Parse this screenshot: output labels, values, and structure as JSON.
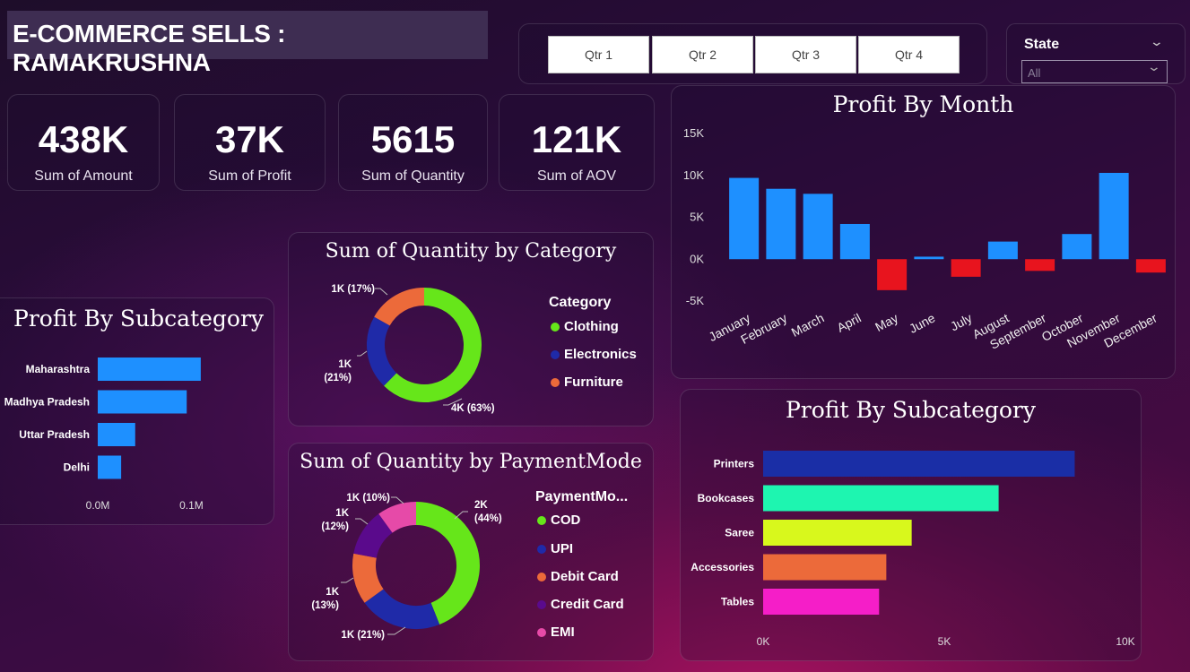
{
  "header": {
    "title": "E-COMMERCE SELLS : RAMAKRUSHNA"
  },
  "quarters": [
    "Qtr 1",
    "Qtr 2",
    "Qtr 3",
    "Qtr 4"
  ],
  "state_filter": {
    "label": "State",
    "value": "All"
  },
  "kpis": [
    {
      "value": "438K",
      "label": "Sum of Amount"
    },
    {
      "value": "37K",
      "label": "Sum of Profit"
    },
    {
      "value": "5615",
      "label": "Sum of Quantity"
    },
    {
      "value": "121K",
      "label": "Sum of AOV"
    }
  ],
  "colors": {
    "positive": "#1e90ff",
    "negative": "#e8141e",
    "bar_blue": "#1e90ff"
  },
  "chart_data": [
    {
      "type": "bar",
      "title": "Profit By Month",
      "categories": [
        "January",
        "February",
        "March",
        "April",
        "May",
        "June",
        "July",
        "August",
        "September",
        "October",
        "November",
        "December"
      ],
      "values": [
        9700,
        8400,
        7800,
        4200,
        -3700,
        300,
        -2100,
        2100,
        -1400,
        3000,
        10300,
        -1600
      ],
      "ylim": [
        -5000,
        15000
      ],
      "yticks": [
        15000,
        10000,
        5000,
        0,
        -5000
      ],
      "ytick_labels": [
        "15K",
        "10K",
        "5K",
        "0K",
        "-5K"
      ],
      "colors": {
        "positive": "#1e90ff",
        "negative": "#e8141e"
      }
    },
    {
      "type": "bar",
      "orientation": "horizontal",
      "title": "Profit By Subcategory",
      "categories": [
        "Maharashtra",
        "Madhya Pradesh",
        "Uttar Pradesh",
        "Delhi"
      ],
      "values": [
        0.11,
        0.095,
        0.04,
        0.025
      ],
      "xlim": [
        0,
        0.18
      ],
      "xticks": [
        0,
        0.1
      ],
      "xtick_labels": [
        "0.0M",
        "0.1M"
      ]
    },
    {
      "type": "pie",
      "title": "Sum of Quantity by Category",
      "legend_title": "Category",
      "slices": [
        {
          "name": "Clothing",
          "value": 63,
          "label": "4K (63%)",
          "color": "#66e61a"
        },
        {
          "name": "Electronics",
          "value": 21,
          "label": "1K\n(21%)",
          "color": "#1f2aa8"
        },
        {
          "name": "Furniture",
          "value": 17,
          "label": "1K (17%)",
          "color": "#ec6a3a"
        }
      ]
    },
    {
      "type": "pie",
      "title": "Sum of Quantity by PaymentMode",
      "legend_title": "PaymentMo...",
      "slices": [
        {
          "name": "COD",
          "value": 44,
          "label": "2K\n(44%)",
          "color": "#66e61a"
        },
        {
          "name": "UPI",
          "value": 21,
          "label": "1K (21%)",
          "color": "#1f2aa8"
        },
        {
          "name": "Debit Card",
          "value": 13,
          "label": "1K\n(13%)",
          "color": "#ec6a3a"
        },
        {
          "name": "Credit Card",
          "value": 12,
          "label": "1K\n(12%)",
          "color": "#5a0a8c"
        },
        {
          "name": "EMI",
          "value": 10,
          "label": "1K (10%)",
          "color": "#e64aa8"
        }
      ]
    },
    {
      "type": "bar",
      "orientation": "horizontal",
      "title": "Profit By Subcategory",
      "categories": [
        "Printers",
        "Bookcases",
        "Saree",
        "Accessories",
        "Tables"
      ],
      "values": [
        8600,
        6500,
        4100,
        3400,
        3200
      ],
      "colors": [
        "#1a2ea6",
        "#1ef5b0",
        "#d8f81c",
        "#ec6a3a",
        "#f51ec8"
      ],
      "xlim": [
        0,
        10000
      ],
      "xticks": [
        0,
        5000,
        10000
      ],
      "xtick_labels": [
        "0K",
        "5K",
        "10K"
      ]
    }
  ]
}
